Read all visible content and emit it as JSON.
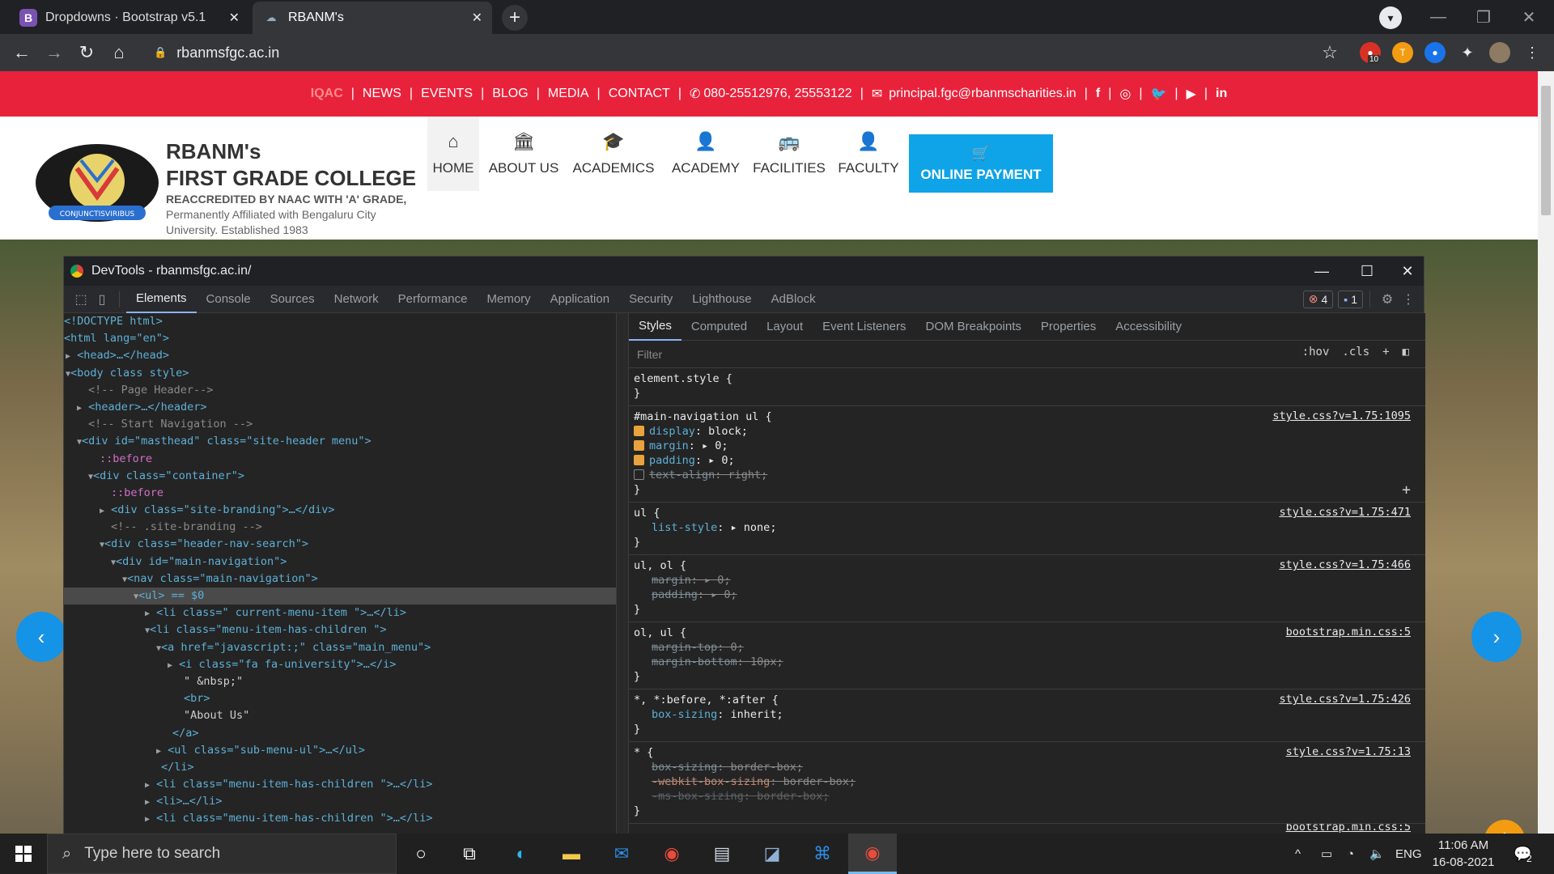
{
  "browser": {
    "tabs": [
      {
        "title": "Dropdowns · Bootstrap v5.1",
        "icon": "bootstrap-icon",
        "active": false
      },
      {
        "title": "RBANM's",
        "icon": "rbanm-favicon",
        "active": true
      }
    ],
    "new_tab": "+",
    "url": "rbanmsfgc.ac.in",
    "ext_badge": "10"
  },
  "site": {
    "topbar": {
      "iqac": "IQAC",
      "news": "NEWS",
      "events": "EVENTS",
      "blog": "BLOG",
      "media": "MEDIA",
      "contact": "CONTACT",
      "phone": "080-25512976, 25553122",
      "email": "principal.fgc@rbanmscharities.in"
    },
    "brand": {
      "line1": "RBANM's",
      "line2": "FIRST GRADE COLLEGE",
      "line3": "REACCREDITED BY NAAC WITH 'A' GRADE,",
      "line4": "Permanently Affiliated with Bengaluru City University. Established 1983",
      "motto": "CONJUNCTISVIRIBUS"
    },
    "nav": [
      {
        "label": "HOME",
        "icon": "home-icon"
      },
      {
        "label": "ABOUT US",
        "icon": "university-icon"
      },
      {
        "label": "ACADEMICS",
        "icon": "graduation-cap-icon"
      },
      {
        "label": "ACADEMY",
        "icon": "user-icon"
      },
      {
        "label": "FACILITIES",
        "icon": "bus-icon"
      },
      {
        "label": "FACULTY",
        "icon": "user-icon"
      }
    ],
    "payment": "ONLINE PAYMENT"
  },
  "devtools": {
    "title": "DevTools - rbanmsfgc.ac.in/",
    "tabs": [
      "Elements",
      "Console",
      "Sources",
      "Network",
      "Performance",
      "Memory",
      "Application",
      "Security",
      "Lighthouse",
      "AdBlock"
    ],
    "errors": "4",
    "messages": "1",
    "elements": [
      "<!DOCTYPE html>",
      "<html lang=\"en\">",
      "<head>…</head>",
      "<body class style>",
      "<!-- Page Header-->",
      "<header>…</header>",
      "<!-- Start Navigation -->",
      "<div id=\"masthead\" class=\"site-header menu\">",
      "::before",
      "<div class=\"container\">",
      "::before",
      "<div class=\"site-branding\">…</div>",
      "<!-- .site-branding -->",
      "<div class=\"header-nav-search\">",
      "<div id=\"main-navigation\">",
      "<nav class=\"main-navigation\">",
      "<ul> == $0",
      "<li class=\" current-menu-item \">…</li>",
      "<li class=\"menu-item-has-children \">",
      "<a href=\"javascript:;\" class=\"main_menu\">",
      "<i class=\"fa fa-university\">…</i>",
      "\" &nbsp;\"",
      "<br>",
      "\"About Us\"",
      "</a>",
      "<ul class=\"sub-menu-ul\">…</ul>",
      "</li>",
      "<li class=\"menu-item-has-children \">…</li>",
      "<li>…</li>",
      "<li class=\"menu-item-has-children \">…</li>"
    ],
    "styles_tabs": [
      "Styles",
      "Computed",
      "Layout",
      "Event Listeners",
      "DOM Breakpoints",
      "Properties",
      "Accessibility"
    ],
    "filter_placeholder": "Filter",
    "hov": ":hov",
    "cls": ".cls",
    "rules": [
      {
        "selector": "element.style {",
        "source": "",
        "props": []
      },
      {
        "selector": "#main-navigation ul {",
        "source": "style.css?v=1.75:1095",
        "props": [
          {
            "text": "display: block;",
            "name": "display",
            "value": "block;",
            "checked": true,
            "struck": false
          },
          {
            "text": "margin: ▸ 0;",
            "name": "margin",
            "value": "▸ 0;",
            "checked": true,
            "struck": false
          },
          {
            "text": "padding: ▸ 0;",
            "name": "padding",
            "value": "▸ 0;",
            "checked": true,
            "struck": false
          },
          {
            "text": "text-align: right;",
            "name": "text-align",
            "value": "right;",
            "checked": false,
            "struck": true
          }
        ]
      },
      {
        "selector": "ul {",
        "source": "style.css?v=1.75:471",
        "props": [
          {
            "name": "list-style",
            "value": "▸ none;",
            "struck": false
          }
        ]
      },
      {
        "selector": "ul, ol {",
        "source": "style.css?v=1.75:466",
        "props": [
          {
            "name": "margin",
            "value": "▸ 0;",
            "struck": true
          },
          {
            "name": "padding",
            "value": "▸ 0;",
            "struck": true
          }
        ]
      },
      {
        "selector": "ol, ul {",
        "source": "bootstrap.min.css:5",
        "props": [
          {
            "name": "margin-top",
            "value": "0;",
            "struck": true
          },
          {
            "name": "margin-bottom",
            "value": "10px;",
            "struck": true
          }
        ]
      },
      {
        "selector": "*, *:before, *:after {",
        "source": "style.css?v=1.75:426",
        "props": [
          {
            "name": "box-sizing",
            "value": "inherit;",
            "struck": false
          }
        ]
      },
      {
        "selector": "* {",
        "source": "style.css?v=1.75:13",
        "props": [
          {
            "name": "box-sizing",
            "value": "border-box;",
            "struck": true
          },
          {
            "name": "-webkit-box-sizing",
            "value": "border-box;",
            "struck": true
          },
          {
            "name": "-ms-box-sizing",
            "value": "border-box;",
            "struck": true
          }
        ]
      }
    ],
    "last_source": "bootstrap.min.css:5"
  },
  "taskbar": {
    "search_placeholder": "Type here to search",
    "lang": "ENG",
    "time": "11:06 AM",
    "date": "16-08-2021",
    "notif": "2"
  }
}
